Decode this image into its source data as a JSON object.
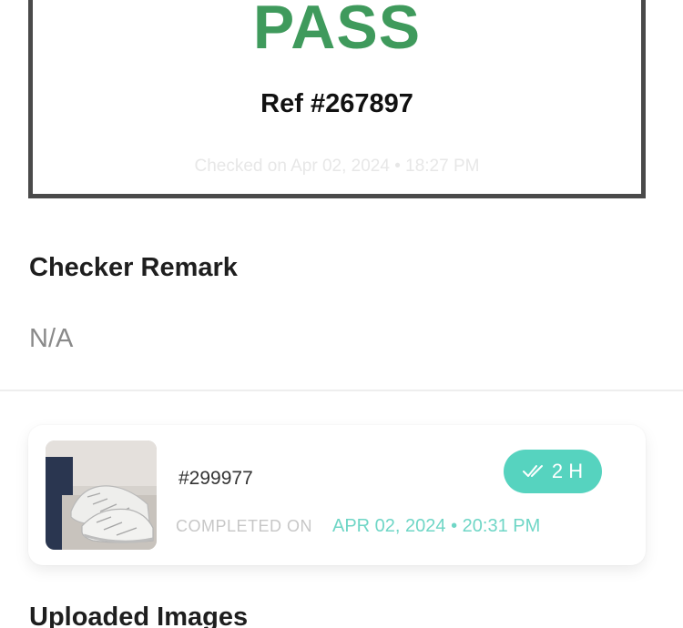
{
  "result": {
    "status": "PASS",
    "ref": "Ref #267897",
    "checked_on": "Checked on Apr 02, 2024 • 18:27 PM",
    "status_color": "#3f9a5c"
  },
  "remark": {
    "title": "Checker Remark",
    "value": "N/A"
  },
  "job": {
    "id": "#299977",
    "badge": "2 H",
    "badge_icon": "double-check-icon",
    "badge_color": "#56d3bf",
    "completed_label": "COMPLETED ON",
    "completed_date": "APR 02, 2024 • 20:31 PM",
    "thumbnail": "sneakers-photo"
  },
  "uploaded": {
    "title": "Uploaded Images"
  }
}
